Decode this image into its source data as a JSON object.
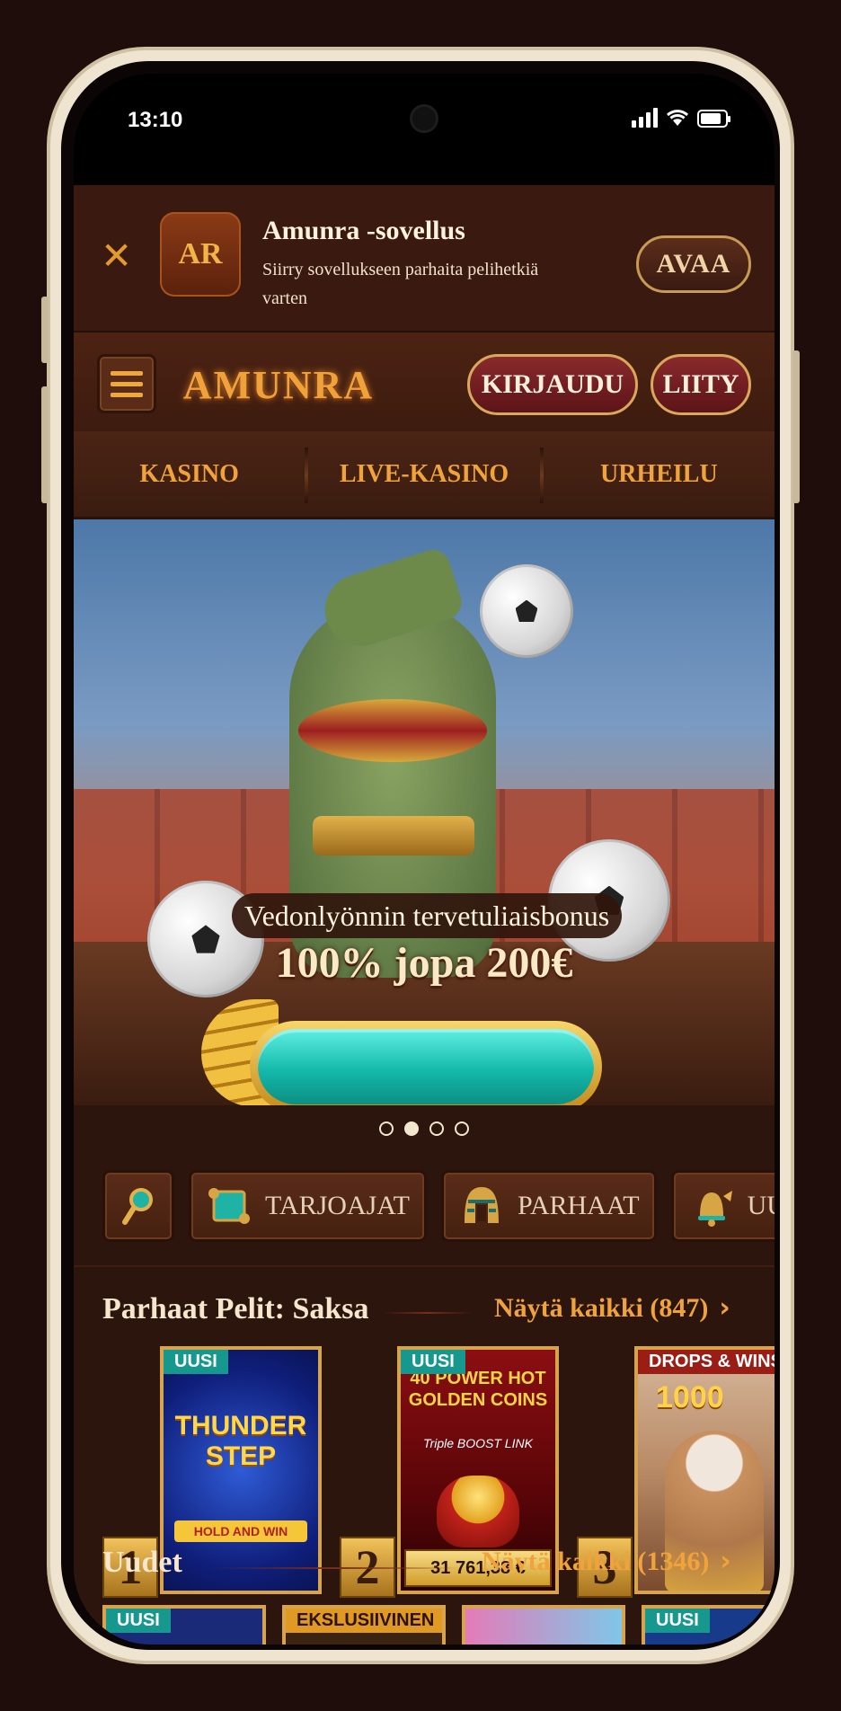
{
  "status_bar": {
    "time": "13:10"
  },
  "app_banner": {
    "title": "Amunra -sovellus",
    "subtitle": "Siirry sovellukseen parhaita pelihetkiä varten",
    "open_label": "AVAA",
    "logo_text": "AR"
  },
  "header": {
    "brand": "AMUNRA",
    "login_label": "KIRJAUDU",
    "join_label": "LIITY"
  },
  "nav": {
    "tabs": [
      "KASINO",
      "LIVE-KASINO",
      "URHEILU"
    ]
  },
  "hero": {
    "label": "Vedonlyönnin tervetuliaisbonus",
    "bonus": "100% jopa 200€",
    "slides": 4,
    "active_slide": 2
  },
  "categories": [
    {
      "icon": "search-icon",
      "label": ""
    },
    {
      "icon": "scroll-icon",
      "label": "TARJOAJAT"
    },
    {
      "icon": "pharaoh-icon",
      "label": "PARHAAT"
    },
    {
      "icon": "bell-icon",
      "label": "UUD"
    }
  ],
  "top_section": {
    "title": "Parhaat Pelit: Saksa",
    "link": "Näytä kaikki (847)",
    "games": [
      {
        "rank": "1",
        "badge": "UUSI",
        "name": "THUNDER STEP",
        "sub": "HOLD AND WIN",
        "jackpot": ""
      },
      {
        "rank": "2",
        "badge": "UUSI",
        "name": "40 POWER HOT GOLDEN COINS",
        "sub": "Triple BOOST LINK",
        "jackpot": "31 761,38 €"
      },
      {
        "rank": "3",
        "badge": "DROPS & WINS",
        "name": "1000",
        "sub": "",
        "jackpot": ""
      }
    ]
  },
  "new_section": {
    "title": "Uudet",
    "link": "Näytä kaikki (1346)",
    "badges": [
      "UUSI",
      "EKSLUSIIVINEN",
      "",
      "UUSI"
    ]
  },
  "colors": {
    "accent_orange": "#f0a33a",
    "teal_badge": "#16988f",
    "button_red": "#8a2a2c",
    "background": "#2c150d"
  }
}
